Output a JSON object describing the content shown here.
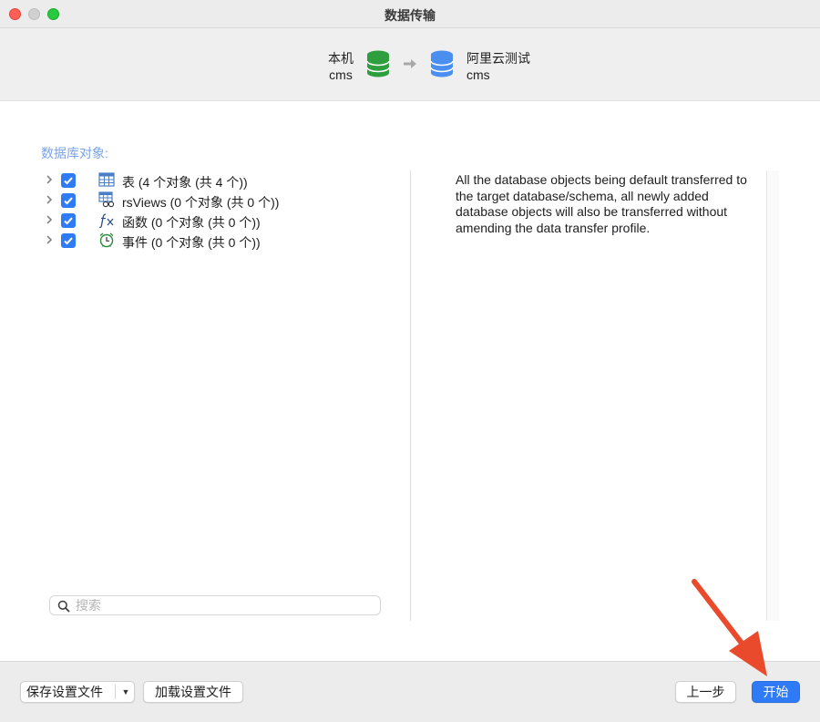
{
  "window": {
    "title": "数据传输"
  },
  "header": {
    "source": {
      "name": "本机",
      "database": "cms"
    },
    "target": {
      "name": "阿里云测试",
      "database": "cms"
    }
  },
  "objects": {
    "section_label": "数据库对象:",
    "items": [
      {
        "label": "表 (4 个对象 (共 4 个))",
        "icon": "table-icon",
        "checked": true
      },
      {
        "label": "rsViews (0 个对象 (共 0 个))",
        "icon": "view-icon",
        "checked": true
      },
      {
        "label": "函数 (0 个对象 (共 0 个))",
        "icon": "function-icon",
        "checked": true
      },
      {
        "label": "事件 (0 个对象 (共 0 个))",
        "icon": "event-clock-icon",
        "checked": true
      }
    ]
  },
  "description": "All the database objects being default transferred to the target database/schema, all newly added database objects will also be transferred without amending the data transfer profile.",
  "search": {
    "placeholder": "搜索",
    "value": ""
  },
  "footer": {
    "save_profile": "保存设置文件",
    "load_profile": "加载设置文件",
    "previous": "上一步",
    "start": "开始"
  },
  "colors": {
    "accent": "#2f7bf5",
    "source_db": "#2e9e3f",
    "target_db": "#4a8ff0",
    "annotation": "#ea4a2c"
  }
}
